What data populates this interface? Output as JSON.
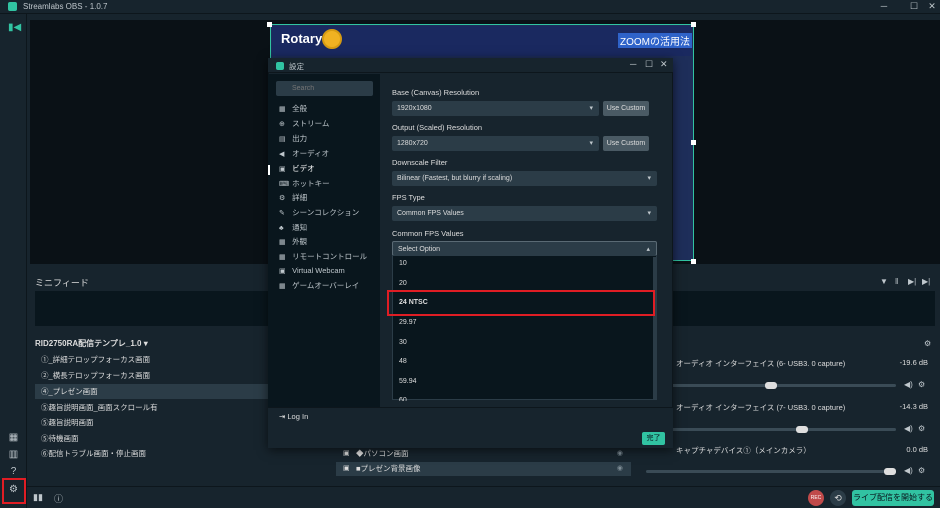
{
  "window": {
    "title": "Streamlabs OBS - 1.0.7",
    "minimize": "─",
    "maximize": "☐",
    "close": "✕"
  },
  "preview": {
    "logo_text": "Rotary",
    "headline": "ZOOMの活用法"
  },
  "minifeed": {
    "title": "ミニフィード",
    "controls": [
      "▼",
      "‖",
      "▶|",
      "▶|"
    ]
  },
  "scenes": {
    "collection": "RID2750RA配信テンプレ_1.0",
    "items": [
      "①_詳細テロップフォーカス画面",
      "②_横長テロップフォーカス画面",
      "④_プレゼン画面",
      "⑤趣旨説明画面_画面スクロール有",
      "⑤趣旨説明画面",
      "⑤待機画面",
      "⑥配信トラブル画面・停止画面"
    ],
    "active_index": 2
  },
  "sources": {
    "items": [
      {
        "label": "◆パソコン画面"
      },
      {
        "label": "■プレゼン背景画像"
      }
    ]
  },
  "mixer": {
    "channels": [
      {
        "name": "オーディオ インターフェイス (6- USB3. 0 capture)",
        "db": "-19.6 dB",
        "level": 0.5
      },
      {
        "name": "オーディオ インターフェイス (7- USB3. 0 capture)",
        "db": "-14.3 dB",
        "level": 0.63
      },
      {
        "name": "キャプチャデバイス①（メインカメラ）",
        "db": "0.0 dB",
        "level": 1.0
      }
    ]
  },
  "footer": {
    "rec_label": "REC",
    "go_live_label": "ライブ配信を開始する"
  },
  "dialog": {
    "title": "設定",
    "search_placeholder": "Search",
    "nav_items": [
      {
        "icon": "▦",
        "label": "全般"
      },
      {
        "icon": "⊕",
        "label": "ストリーム"
      },
      {
        "icon": "▤",
        "label": "出力"
      },
      {
        "icon": "◀",
        "label": "オーディオ"
      },
      {
        "icon": "▣",
        "label": "ビデオ"
      },
      {
        "icon": "⌨",
        "label": "ホットキー"
      },
      {
        "icon": "⚙",
        "label": "詳細"
      },
      {
        "icon": "✎",
        "label": "シーンコレクション"
      },
      {
        "icon": "♣",
        "label": "通知"
      },
      {
        "icon": "▦",
        "label": "外観"
      },
      {
        "icon": "▦",
        "label": "リモートコントロール"
      },
      {
        "icon": "▣",
        "label": "Virtual Webcam"
      },
      {
        "icon": "▦",
        "label": "ゲームオーバーレイ"
      }
    ],
    "active_nav_index": 4,
    "base_resolution_label": "Base (Canvas) Resolution",
    "base_resolution_value": "1920x1080",
    "output_resolution_label": "Output (Scaled) Resolution",
    "output_resolution_value": "1280x720",
    "use_custom_label": "Use Custom",
    "downscale_label": "Downscale Filter",
    "downscale_value": "Bilinear (Fastest, but blurry if scaling)",
    "fps_type_label": "FPS Type",
    "fps_type_value": "Common FPS Values",
    "common_fps_label": "Common FPS Values",
    "common_fps_value": "Select Option",
    "fps_options": [
      "10",
      "20",
      "24 NTSC",
      "29.97",
      "30",
      "48",
      "59.94",
      "60"
    ],
    "highlighted_option_index": 2,
    "login_label": "Log In",
    "done_label": "完了"
  },
  "colors": {
    "accent": "#31c3a2",
    "background": "#17242d",
    "panel_dark": "#09161d",
    "highlight_red": "#e01d24"
  }
}
